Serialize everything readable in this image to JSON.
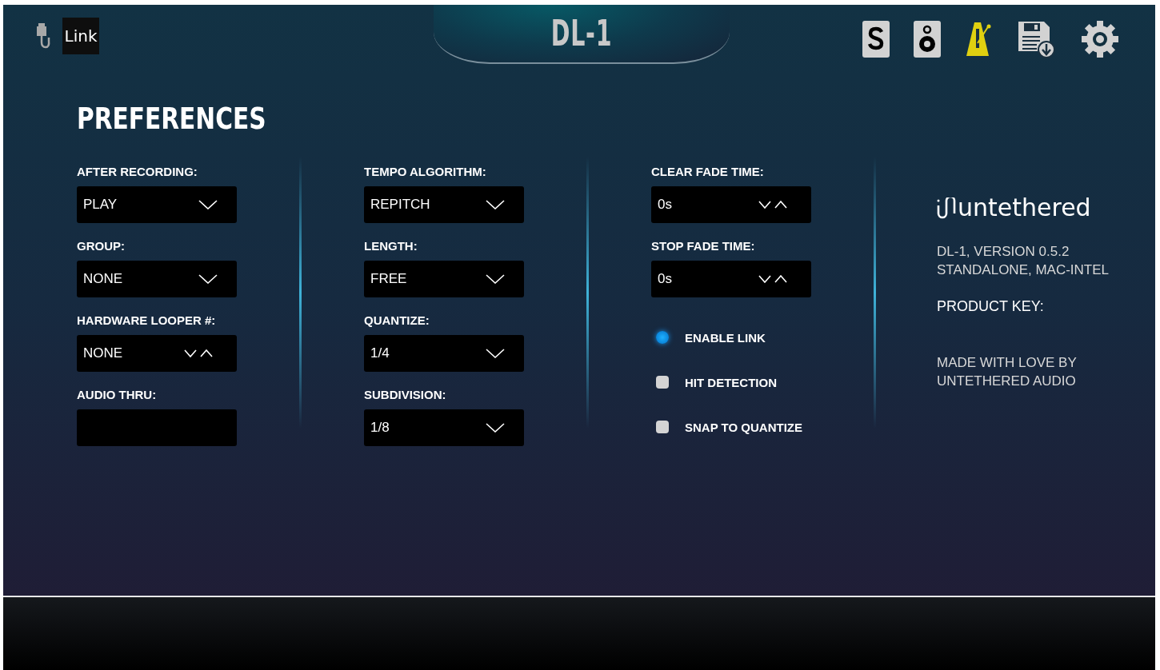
{
  "header": {
    "title": "DL-1",
    "link_label": "Link"
  },
  "page_title": "PREFERENCES",
  "columns": [
    {
      "fields": [
        {
          "label": "AFTER RECORDING:",
          "kind": "dropdown",
          "value": "PLAY"
        },
        {
          "label": "GROUP:",
          "kind": "dropdown",
          "value": "NONE"
        },
        {
          "label": "HARDWARE LOOPER #:",
          "kind": "spinner",
          "value": "NONE"
        },
        {
          "label": "AUDIO THRU:",
          "kind": "blank"
        }
      ]
    },
    {
      "fields": [
        {
          "label": "TEMPO ALGORITHM:",
          "kind": "dropdown",
          "value": "REPITCH"
        },
        {
          "label": "LENGTH:",
          "kind": "dropdown",
          "value": "FREE"
        },
        {
          "label": "QUANTIZE:",
          "kind": "dropdown",
          "value": "1/4"
        },
        {
          "label": "SUBDIVISION:",
          "kind": "dropdown",
          "value": "1/8"
        }
      ]
    },
    {
      "fields": [
        {
          "label": "CLEAR FADE TIME:",
          "kind": "spinner",
          "value": "0s"
        },
        {
          "label": "STOP FADE TIME:",
          "kind": "spinner",
          "value": "0s"
        }
      ],
      "toggles": [
        {
          "label": "ENABLE LINK",
          "checked": true
        },
        {
          "label": "HIT DETECTION",
          "checked": false
        },
        {
          "label": "SNAP TO QUANTIZE",
          "checked": false
        }
      ]
    }
  ],
  "about": {
    "brand": "untethered",
    "version": [
      "DL-1, VERSION 0.5.2",
      "STANDALONE, MAC-INTEL"
    ],
    "product_key": "PRODUCT KEY:",
    "credits": [
      "MADE WITH LOVE BY",
      "UNTETHERED AUDIO"
    ]
  }
}
